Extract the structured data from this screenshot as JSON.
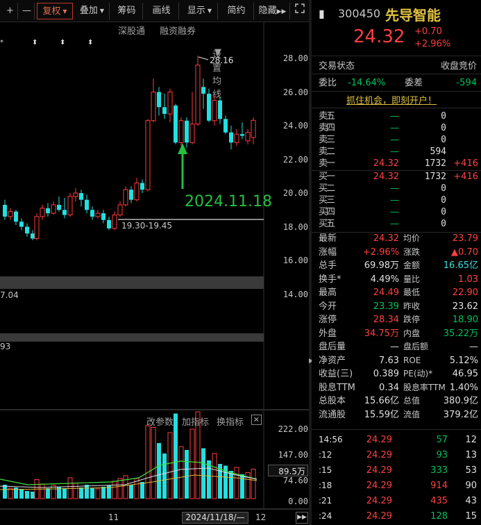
{
  "toolbar": {
    "plus": "+",
    "minus": "—",
    "fuquan": "复权",
    "diejia": "叠加",
    "chouma": "筹码",
    "huaxian": "画线",
    "xianshi": "显示",
    "jianyue": "简约",
    "yincang": "隐藏"
  },
  "subbar": {
    "shengu": "深股通",
    "rongzi": "融资融券",
    "shezhi": "设置均线"
  },
  "annotations": {
    "high": "28.16",
    "date": "2024.11.18",
    "range": "19.30-19.45",
    "low": "7.04",
    "left93": "93"
  },
  "price_axis": [
    "28.00",
    "26.00",
    "24.00",
    "22.00",
    "20.00",
    "18.00",
    "16.00",
    "14.00"
  ],
  "volume": {
    "gaicanshu": "改参数",
    "jiazhibiao": "加指标",
    "huanzhibiao": "换指标",
    "axis": [
      "222.00",
      "147.00",
      "74.60",
      "0.00"
    ],
    "current": "89.5万"
  },
  "bottom": {
    "x11": "11",
    "x12": "12",
    "cursor": "2024/11/18/—"
  },
  "stock": {
    "code": "300450",
    "name": "先导智能",
    "price": "24.32",
    "change": "+0.70",
    "pct": "+2.96%"
  },
  "status": {
    "left": "交易状态",
    "right": "收盘竞价"
  },
  "weibi": {
    "label": "委比",
    "value": "-14.64%",
    "label2": "委差",
    "value2": "-594"
  },
  "banner": "抓住机会，即刻开户！",
  "asks": [
    {
      "label": "卖五",
      "price": "—",
      "vol": "0",
      "chg": ""
    },
    {
      "label": "卖四",
      "price": "—",
      "vol": "0",
      "chg": ""
    },
    {
      "label": "卖三",
      "price": "—",
      "vol": "0",
      "chg": ""
    },
    {
      "label": "卖二",
      "price": "—",
      "vol": "594",
      "chg": ""
    },
    {
      "label": "卖一",
      "price": "24.32",
      "vol": "1732",
      "chg": "+416"
    }
  ],
  "bids": [
    {
      "label": "买一",
      "price": "24.32",
      "vol": "1732",
      "chg": "+416"
    },
    {
      "label": "买二",
      "price": "—",
      "vol": "0",
      "chg": ""
    },
    {
      "label": "买三",
      "price": "—",
      "vol": "0",
      "chg": ""
    },
    {
      "label": "买四",
      "price": "—",
      "vol": "0",
      "chg": ""
    },
    {
      "label": "买五",
      "price": "—",
      "vol": "0",
      "chg": ""
    }
  ],
  "stats": [
    {
      "l1": "最新",
      "v1": "24.32",
      "c1": "red",
      "l2": "均价",
      "v2": "23.79",
      "c2": "red"
    },
    {
      "l1": "涨幅",
      "v1": "+2.96%",
      "c1": "red",
      "l2": "涨跌",
      "v2": "▲0.70",
      "c2": "red"
    },
    {
      "l1": "总手",
      "v1": "69.98万",
      "c1": "wht",
      "l2": "金额",
      "v2": "16.65亿",
      "c2": "cyan"
    },
    {
      "l1": "换手*",
      "v1": "4.49%",
      "c1": "wht",
      "l2": "量比",
      "v2": "1.03",
      "c2": "red"
    },
    {
      "l1": "最高",
      "v1": "24.49",
      "c1": "red",
      "l2": "最低",
      "v2": "22.90",
      "c2": "red"
    },
    {
      "l1": "今开",
      "v1": "23.39",
      "c1": "grn",
      "l2": "昨收",
      "v2": "23.62",
      "c2": "wht"
    },
    {
      "l1": "涨停",
      "v1": "28.34",
      "c1": "red",
      "l2": "跌停",
      "v2": "18.90",
      "c2": "grn"
    },
    {
      "l1": "外盘",
      "v1": "34.75万",
      "c1": "red",
      "l2": "内盘",
      "v2": "35.22万",
      "c2": "grn"
    },
    {
      "l1": "盘后量",
      "v1": "—",
      "c1": "wht",
      "l2": "盘后额",
      "v2": "—",
      "c2": "wht"
    },
    {
      "l1": "净资产",
      "v1": "7.63",
      "c1": "wht",
      "l2": "ROE",
      "v2": "5.12%",
      "c2": "wht"
    },
    {
      "l1": "收益(三)",
      "v1": "0.389",
      "c1": "wht",
      "l2": "PE(动)*",
      "v2": "46.95",
      "c2": "wht"
    },
    {
      "l1": "股息TTM",
      "v1": "0.34",
      "c1": "wht",
      "l2": "股息率TTM",
      "v2": "1.40%",
      "c2": "wht"
    },
    {
      "l1": "总股本",
      "v1": "15.66亿",
      "c1": "wht",
      "l2": "总值",
      "v2": "380.9亿",
      "c2": "wht"
    },
    {
      "l1": "流通股",
      "v1": "15.59亿",
      "c1": "wht",
      "l2": "流值",
      "v2": "379.2亿",
      "c2": "wht"
    }
  ],
  "ticks": [
    {
      "t": "14:56",
      "p": "24.29",
      "v": "57",
      "n": "12",
      "vc": "grn"
    },
    {
      "t": ":12",
      "p": "24.29",
      "v": "93",
      "n": "13",
      "vc": "grn"
    },
    {
      "t": ":15",
      "p": "24.29",
      "v": "333",
      "n": "53",
      "vc": "grn"
    },
    {
      "t": ":18",
      "p": "24.29",
      "v": "914",
      "n": "90",
      "vc": "red"
    },
    {
      "t": ":21",
      "p": "24.29",
      "v": "435",
      "n": "43",
      "vc": "red"
    },
    {
      "t": ":24",
      "p": "24.29",
      "v": "128",
      "n": "15",
      "vc": "grn"
    }
  ]
}
